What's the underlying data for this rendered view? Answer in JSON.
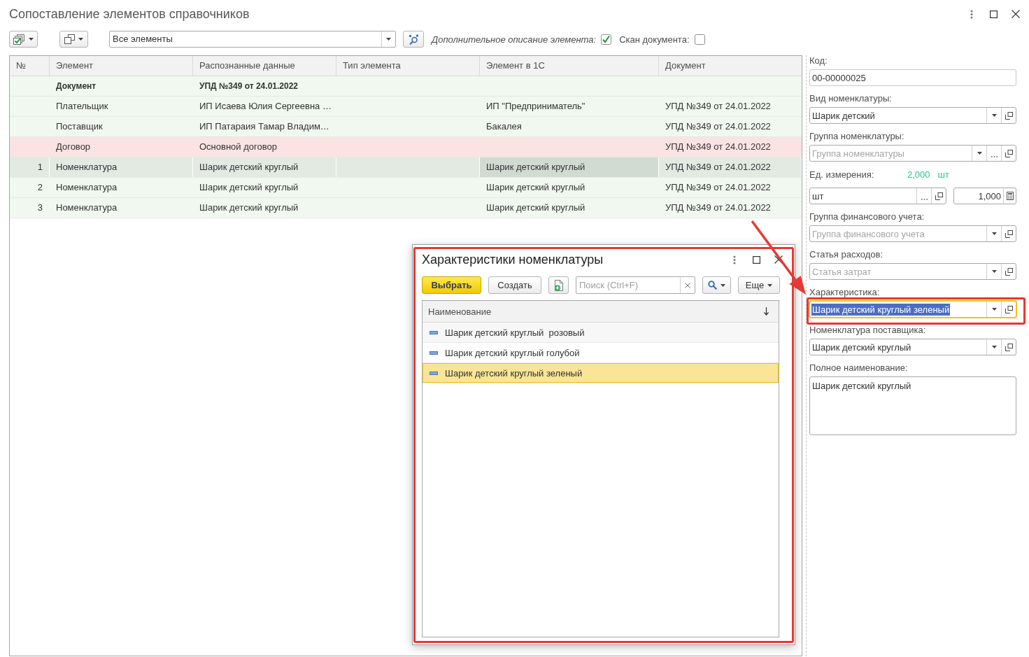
{
  "window": {
    "title": "Сопоставление элементов справочников"
  },
  "toolbar": {
    "filter": {
      "value": "Все элементы"
    },
    "options": [
      {
        "label": "Дополнительное описание элемента:",
        "kind": "emphasized",
        "checked": true
      },
      {
        "label": "Скан документа:",
        "kind": "plain",
        "checked": false
      }
    ]
  },
  "table": {
    "columns": [
      {
        "label": "№",
        "current": false
      },
      {
        "label": "Элемент",
        "current": false
      },
      {
        "label": "Распознанные данные",
        "current": false
      },
      {
        "label": "Тип элемента",
        "current": false
      },
      {
        "label": "Элемент в 1С",
        "current": true
      },
      {
        "label": "Документ",
        "current": false
      }
    ],
    "rows": [
      {
        "kind": "group",
        "element": "Документ",
        "recognized": "УПД №349 от 24.01.2022",
        "matched": true,
        "selected": false
      },
      {
        "kind": "item",
        "element": "Плательщик",
        "recognized": "ИП Исаева Юлия Сергеевна …",
        "element_1c": "ИП \"Предприниматель\"",
        "document": "УПД №349 от 24.01.2022",
        "matched": true,
        "selected": false
      },
      {
        "kind": "item",
        "element": "Поставщик",
        "recognized": "ИП Патараия Тамар Владим…",
        "element_1c": "Бакалея",
        "document": "УПД №349 от 24.01.2022",
        "matched": true,
        "selected": false
      },
      {
        "kind": "item",
        "element": "Договор",
        "recognized": "Основной договор",
        "document": "УПД №349 от 24.01.2022",
        "matched": false,
        "selected": false
      },
      {
        "kind": "item",
        "number": "1",
        "element": "Номенклатура",
        "recognized": "Шарик детский круглый",
        "element_1c": "Шарик детский круглый",
        "document": "УПД №349 от 24.01.2022",
        "matched": true,
        "selected": true
      },
      {
        "kind": "item",
        "number": "2",
        "element": "Номенклатура",
        "recognized": "Шарик детский круглый",
        "element_1c": "Шарик детский круглый",
        "document": "УПД №349 от 24.01.2022",
        "matched": true,
        "selected": false
      },
      {
        "kind": "item",
        "number": "3",
        "element": "Номенклатура",
        "recognized": "Шарик детский круглый",
        "element_1c": "Шарик детский круглый",
        "document": "УПД №349 от 24.01.2022",
        "matched": true,
        "selected": false
      }
    ]
  },
  "form": {
    "fields": [
      {
        "kind": "text",
        "label": "Код:",
        "value": "00-00000025",
        "focused": false
      },
      {
        "kind": "select",
        "label": "Вид номенклатуры:",
        "value": "Шарик детский",
        "focused": false
      },
      {
        "kind": "select",
        "label": "Группа номенклатуры:",
        "placeholder": "Группа номенклатуры",
        "picker": true,
        "focused": false
      },
      {
        "kind": "unit",
        "label": "Ед. измерения:",
        "ratio": "2,000",
        "ratio_unit": "шт",
        "value": "шт",
        "quantity": "1,000",
        "picker": true,
        "focused": false
      },
      {
        "kind": "select",
        "label": "Группа финансового учета:",
        "placeholder": "Группа финансового учета",
        "focused": false
      },
      {
        "kind": "select",
        "label": "Статья расходов:",
        "placeholder": "Статья затрат",
        "focused": false
      },
      {
        "kind": "select",
        "label": "Характеристика:",
        "value": "Шарик детский круглый зеленый",
        "focused": true
      },
      {
        "kind": "select",
        "label": "Номенклатура поставщика:",
        "value": "Шарик детский круглый",
        "focused": false
      },
      {
        "kind": "textarea",
        "label": "Полное наименование:",
        "value": "Шарик детский круглый",
        "focused": false
      }
    ]
  },
  "dialog": {
    "title": "Характеристики номенклатуры",
    "buttons": [
      {
        "label": "Выбрать",
        "kind": "primary"
      },
      {
        "label": "Создать",
        "kind": "default"
      }
    ],
    "search": {
      "placeholder": "Поиск (Ctrl+F)"
    },
    "more": {
      "label": "Еще"
    },
    "list": {
      "column": "Наименование",
      "items": [
        {
          "name": "Шарик детский круглый  розовый",
          "selected": false
        },
        {
          "name": "Шарик детский круглый голубой",
          "selected": false
        },
        {
          "name": "Шарик детский круглый зеленый",
          "selected": true
        }
      ]
    }
  }
}
